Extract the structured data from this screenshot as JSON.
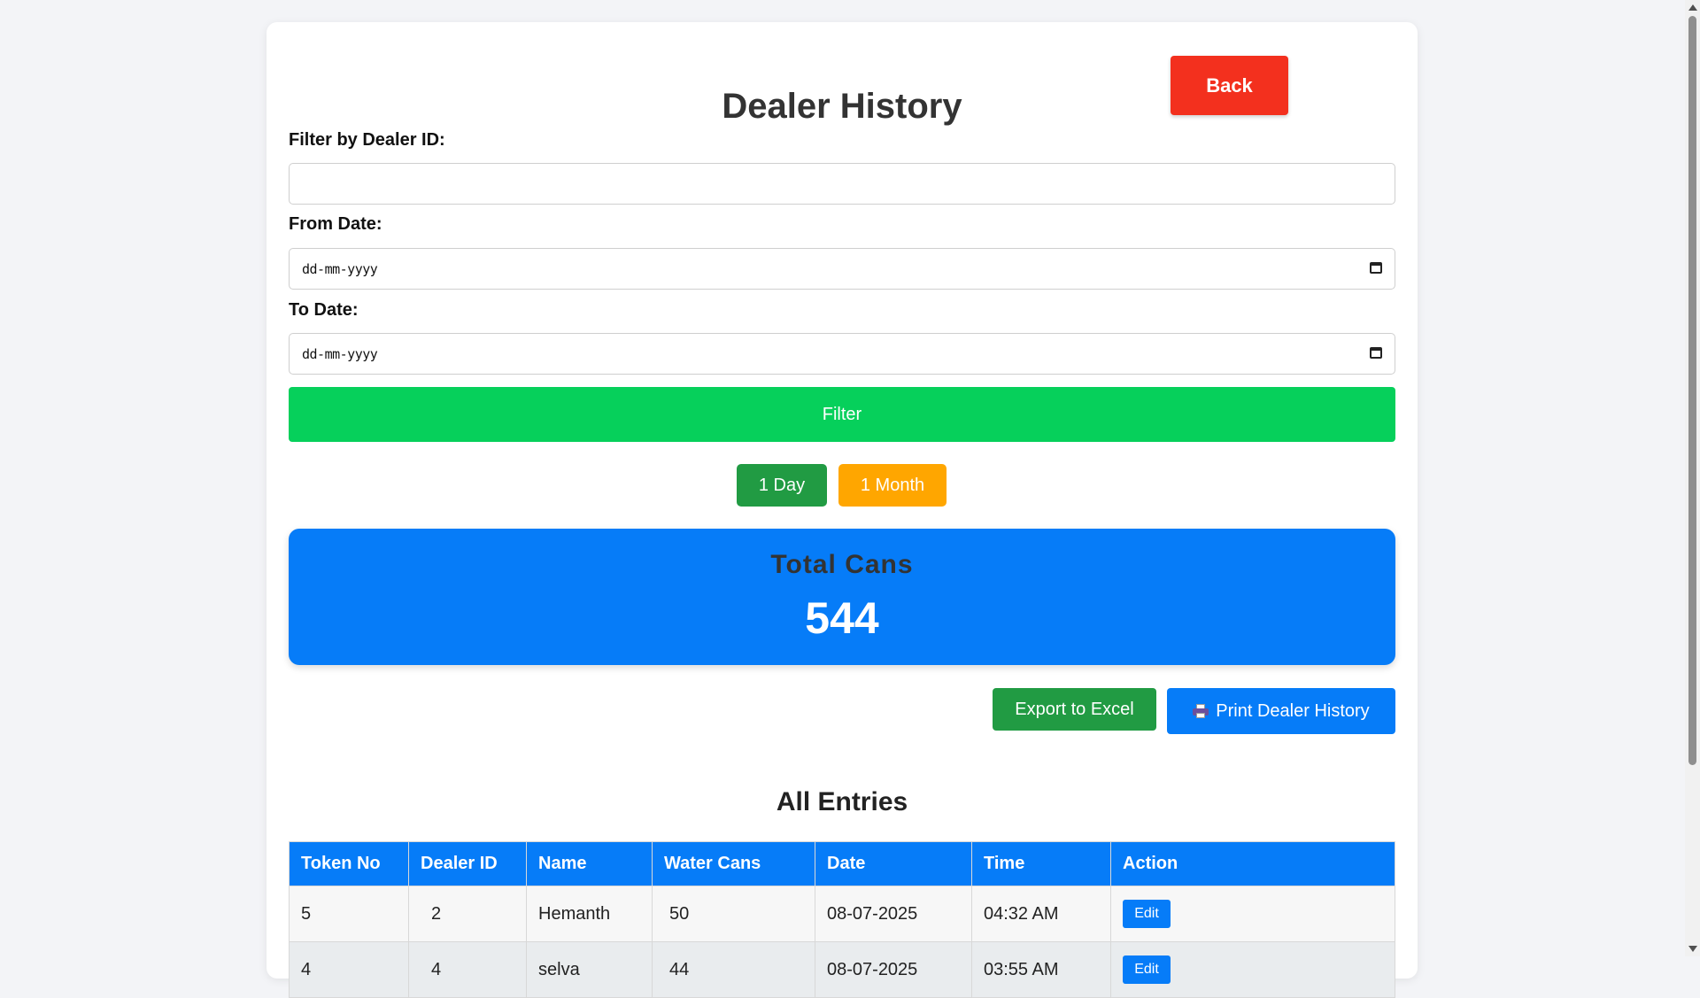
{
  "page": {
    "title": "Dealer History",
    "back_label": "Back"
  },
  "filters": {
    "dealer_label": "Filter by Dealer ID:",
    "dealer_value": "",
    "from_label": "From Date:",
    "from_placeholder": "dd-mm-yyyy",
    "to_label": "To Date:",
    "to_placeholder": "dd-mm-yyyy",
    "filter_label": "Filter",
    "day_label": "1 Day",
    "month_label": "1 Month"
  },
  "summary": {
    "label": "Total Cans",
    "value": "544"
  },
  "actions": {
    "export_label": "Export to Excel",
    "print_label": "Print Dealer History",
    "print_icon": "printer-icon"
  },
  "entries": {
    "title": "All Entries",
    "columns": [
      "Token No",
      "Dealer ID",
      "Name",
      "Water Cans",
      "Date",
      "Time",
      "Action"
    ],
    "rows": [
      {
        "token": "5",
        "dealer_id": "2",
        "name": "Hemanth",
        "cans": "50",
        "date": "08-07-2025",
        "time": "04:32 AM",
        "action": "Edit"
      },
      {
        "token": "4",
        "dealer_id": "4",
        "name": "selva",
        "cans": "44",
        "date": "08-07-2025",
        "time": "03:55 AM",
        "action": "Edit"
      }
    ]
  },
  "colors": {
    "back": "#f3301e",
    "filter": "#06d05b",
    "day": "#219b43",
    "month": "#ffa600",
    "primary": "#067cf8",
    "export": "#219b43"
  }
}
